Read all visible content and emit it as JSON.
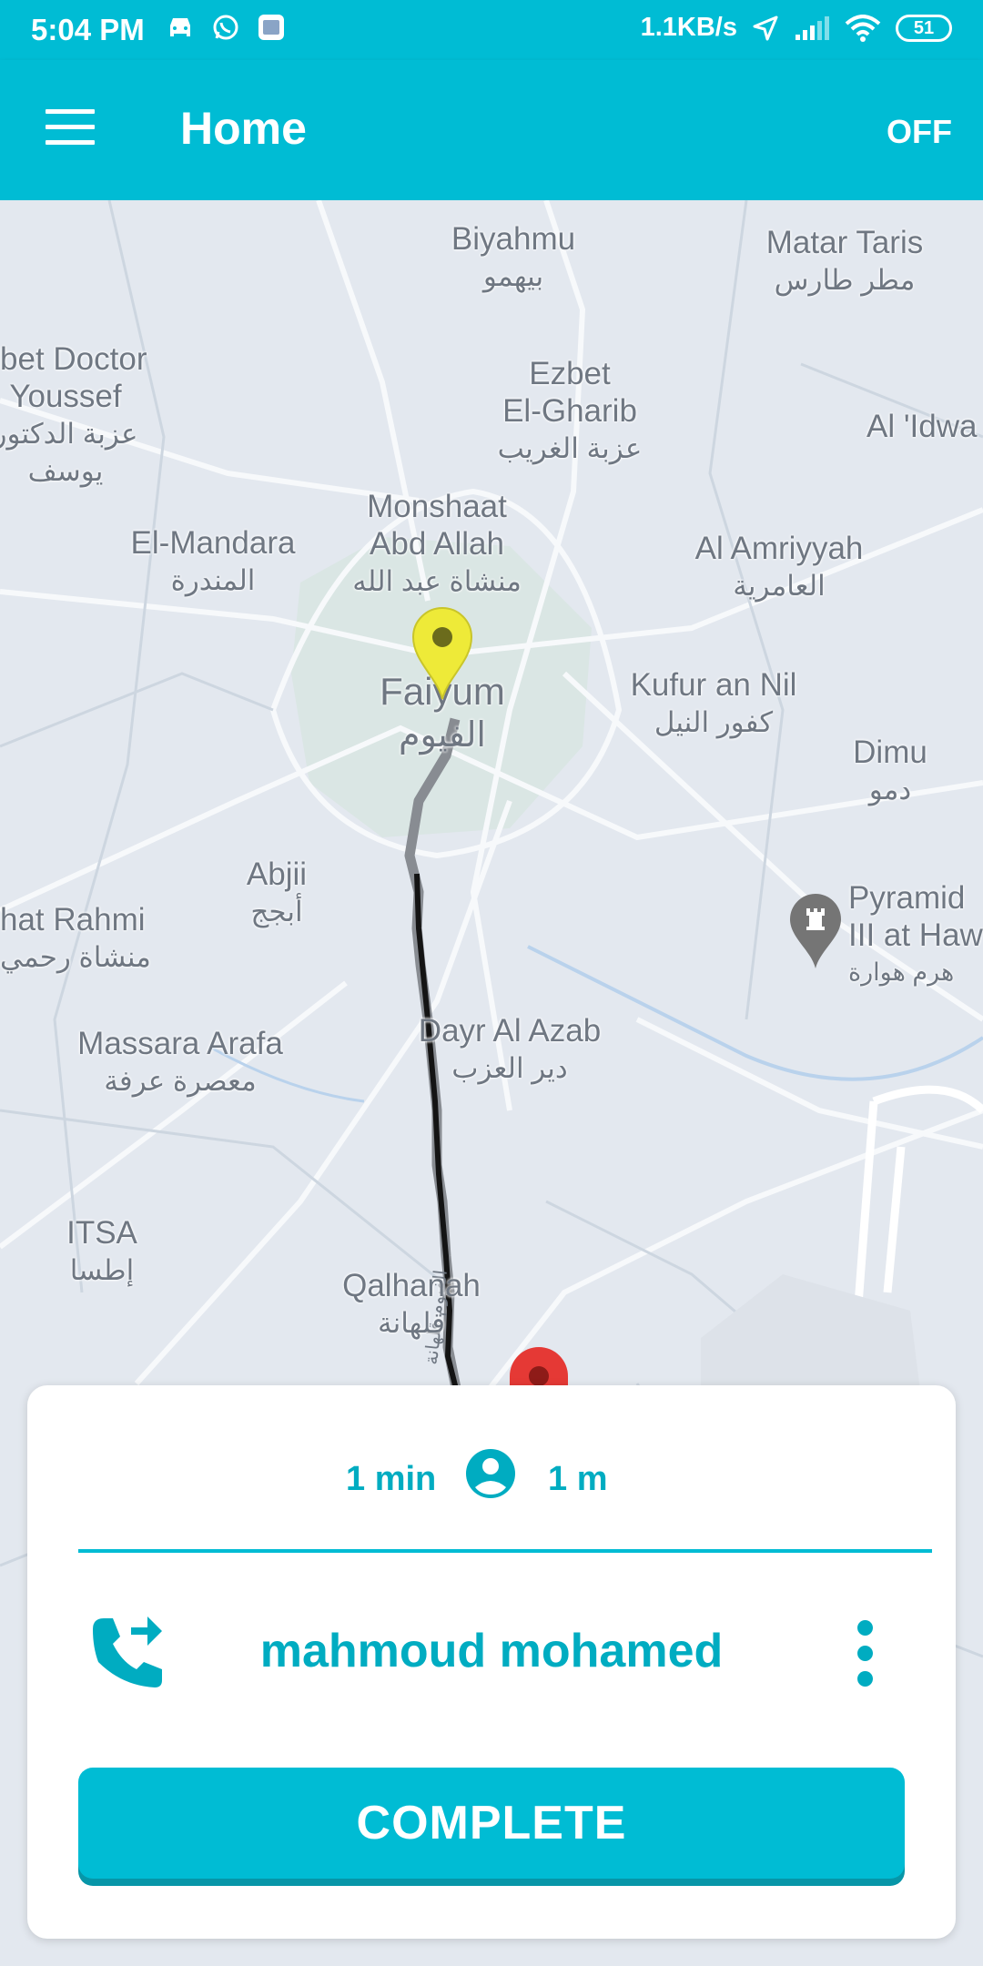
{
  "status_bar": {
    "time": "5:04 PM",
    "speed": "1.1KB/s",
    "battery": "51",
    "icons": [
      "car-icon",
      "whatsapp-icon",
      "app-notification-icon",
      "location-arrow-icon",
      "signal-icon",
      "wifi-icon",
      "battery-icon"
    ]
  },
  "app_bar": {
    "title": "Home",
    "toggle_label": "OFF",
    "menu_icon": "hamburger-menu-icon",
    "background": "#00bcd4"
  },
  "map": {
    "labels": [
      {
        "en": "Biyahmu",
        "ar": "بيهمو"
      },
      {
        "en": "Matar Taris",
        "ar": "مطر طارس"
      },
      {
        "en": "zbet Doctor",
        "en2": "Youssef",
        "ar": "عزبة الدكتور",
        "ar2": "يوسف"
      },
      {
        "en": "Ezbet",
        "en2": "El-Gharib",
        "ar": "عزبة الغريب"
      },
      {
        "en": "Al 'Idwa"
      },
      {
        "en": "Monshaat",
        "en2": "Abd Allah",
        "ar": "منشاة عبد الله"
      },
      {
        "en": "El-Mandara",
        "ar": "المندرة"
      },
      {
        "en": "Al Amriyyah",
        "ar": "العامرية"
      },
      {
        "en": "Faiyum",
        "ar": "الفيوم"
      },
      {
        "en": "Kufur an Nil",
        "ar": "كفور النيل"
      },
      {
        "en": "Dimu",
        "ar": "دمو"
      },
      {
        "en": "Abjii",
        "ar": "أبجج"
      },
      {
        "en": "Pyramid",
        "en2": "III at Haw",
        "ar": "هرم هوارة"
      },
      {
        "en": "hat Rahmi",
        "ar": "منشاة رحمي"
      },
      {
        "en": "Dayr Al Azab",
        "ar": "دير العزب"
      },
      {
        "en": "Massara Arafa",
        "ar": "معصرة عرفة"
      },
      {
        "en": "ITSA",
        "ar": "إطسا"
      },
      {
        "en": "Qalhanah",
        "ar": "قلهانة"
      }
    ],
    "road_label": "الفيوم قلهانة",
    "markers": {
      "origin": "yellow-pin-icon",
      "destination": "red-pin-icon",
      "poi": "pyramid-landmark-icon"
    }
  },
  "trip_card": {
    "eta_time": "1 min",
    "eta_distance": "1 m",
    "person_icon": "account-circle-icon",
    "call_icon": "phone-forwarded-icon",
    "customer_name": "mahmoud mohamed",
    "more_icon": "more-vert-icon",
    "complete_label": "COMPLETE",
    "accent": "#00acc1"
  }
}
